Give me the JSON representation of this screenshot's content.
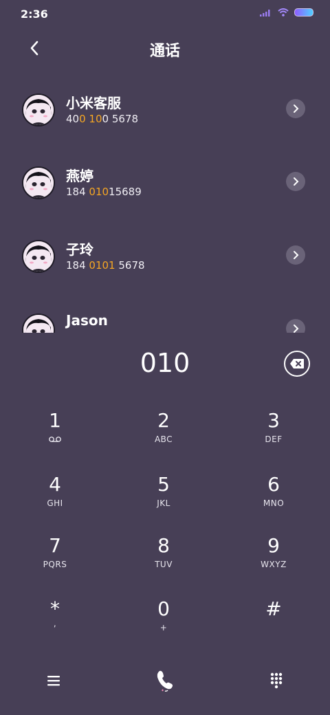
{
  "status_bar": {
    "time": "2:36"
  },
  "header": {
    "title": "通话"
  },
  "contacts": [
    {
      "name": "小米客服",
      "number_parts": [
        "40",
        "0",
        " ",
        "10",
        "0 5678"
      ]
    },
    {
      "name": "燕婷",
      "number_parts": [
        "184 ",
        "010",
        "15689",
        "",
        ""
      ]
    },
    {
      "name": "子玲",
      "number_parts": [
        "184 ",
        "0101",
        " 5678",
        "",
        ""
      ]
    },
    {
      "name": "Jason",
      "number_parts": [
        "",
        "",
        "",
        "",
        ""
      ]
    }
  ],
  "dialer": {
    "input": "010",
    "keys": [
      {
        "digit": "1",
        "letters": ""
      },
      {
        "digit": "2",
        "letters": "ABC"
      },
      {
        "digit": "3",
        "letters": "DEF"
      },
      {
        "digit": "4",
        "letters": "GHI"
      },
      {
        "digit": "5",
        "letters": "JKL"
      },
      {
        "digit": "6",
        "letters": "MNO"
      },
      {
        "digit": "7",
        "letters": "PQRS"
      },
      {
        "digit": "8",
        "letters": "TUV"
      },
      {
        "digit": "9",
        "letters": "WXYZ"
      },
      {
        "digit": "*",
        "letters": ","
      },
      {
        "digit": "0",
        "letters": "+"
      },
      {
        "digit": "#",
        "letters": ""
      }
    ]
  },
  "bottom_nav": {
    "icons": [
      "menu-icon",
      "call-icon",
      "dialpad-icon"
    ]
  },
  "colors": {
    "background": "#473f56",
    "highlight": "#f5a623"
  }
}
